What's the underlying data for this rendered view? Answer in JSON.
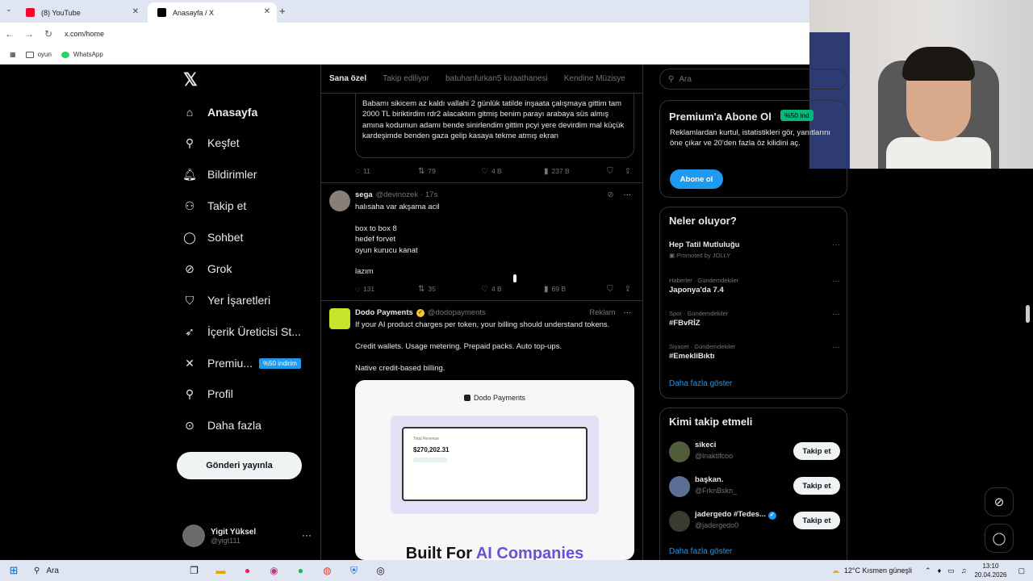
{
  "browser": {
    "tabs": [
      {
        "label": "(8) YouTube"
      },
      {
        "label": "Anasayfa / X"
      }
    ],
    "url": "x.com/home",
    "bookmarks": [
      {
        "label": "oyun"
      },
      {
        "label": "WhatsApp"
      }
    ]
  },
  "sidebar": {
    "items": [
      {
        "label": "Anasayfa"
      },
      {
        "label": "Keşfet"
      },
      {
        "label": "Bildirimler"
      },
      {
        "label": "Takip et"
      },
      {
        "label": "Sohbet"
      },
      {
        "label": "Grok"
      },
      {
        "label": "Yer İşaretleri"
      },
      {
        "label": "İçerik Üreticisi St..."
      },
      {
        "label": "Premiu...",
        "badge": "%50 indirim"
      },
      {
        "label": "Profil"
      },
      {
        "label": "Daha fazla"
      }
    ],
    "post_button": "Gönderi yayınla",
    "profile": {
      "name": "Yigit Yüksel",
      "handle": "@yigt111"
    }
  },
  "feed": {
    "tabs": [
      "Sana özel",
      "Takip ediliyor",
      "batuhanfurkan5 kıraathanesi",
      "Kendine Müzisye"
    ],
    "quoted_text": "Babamı sikicem az kaldı vallahi 2 günlük tatilde inşaata çalışmaya gittim tam 2000 TL biriktirdim rdr2 alacaktım gitmiş benim parayı arabaya süs almış amına kodumun adamı bende sinirlendim gittim pcyi yere devirdim mal küçük kardeşimde benden gaza gelip kasaya tekme atmış ekran",
    "tweet1_stats": {
      "replies": "11",
      "reposts": "79",
      "likes": "4 B",
      "views": "237 B"
    },
    "tweet2": {
      "name": "sega",
      "handle": "@devinozek",
      "time": "· 17s",
      "body": "halısaha var akşama acil\n\nbox to box 8\nhedef forvet\noyun kurucu kanat\n\nlazım",
      "stats": {
        "replies": "131",
        "reposts": "35",
        "likes": "4 B",
        "views": "69 B"
      }
    },
    "tweet3": {
      "name": "Dodo Payments",
      "handle": "@dodopayments",
      "tag": "Reklam",
      "body": "If your AI product charges per token, your billing should understand tokens.\n\nCredit wallets. Usage metering. Prepaid packs. Auto top-ups.\n\nNative credit-based billing.",
      "card": {
        "brand": "Dodo Payments",
        "revenue_label": "Total Revenue",
        "revenue_value": "$270,202.31",
        "headline_prefix": "Built For ",
        "headline_accent": "AI Companies"
      }
    }
  },
  "right": {
    "search_placeholder": "Ara",
    "premium": {
      "title": "Premium'a Abone Ol",
      "badge": "%50 ind",
      "desc": "Reklamlardan kurtul, istatistikleri gör, yanıtlarını öne çıkar ve 20'den fazla öz kilidini aç.",
      "button": "Abone ol"
    },
    "trends_title": "Neler oluyor?",
    "trends": [
      {
        "name": "Hep Tatil Mutluluğu",
        "meta": "Promoted by JOLLY"
      },
      {
        "meta": "Haberler · Gündemdekiler",
        "name": "Japonya'da 7.4"
      },
      {
        "meta": "Spor · Gündemdekiler",
        "name": "#FBvRİZ"
      },
      {
        "meta": "Siyaset · Gündemdekiler",
        "name": "#EmekliBıktı"
      }
    ],
    "trends_more": "Daha fazla göster",
    "who_title": "Kimi takip etmeli",
    "who": [
      {
        "name": "sikeci",
        "handle": "@lnaktifcoo",
        "button": "Takip et"
      },
      {
        "name": "başkan.",
        "handle": "@FrknBskn_",
        "button": "Takip et"
      },
      {
        "name": "jadergedo #Tedes...",
        "handle": "@jadergedo0",
        "button": "Takip et"
      }
    ],
    "who_more": "Daha fazla göster"
  },
  "taskbar": {
    "search": "Ara",
    "weather": "12°C  Kısmen güneşli",
    "time": "13:10",
    "date": "20.04.2026"
  }
}
